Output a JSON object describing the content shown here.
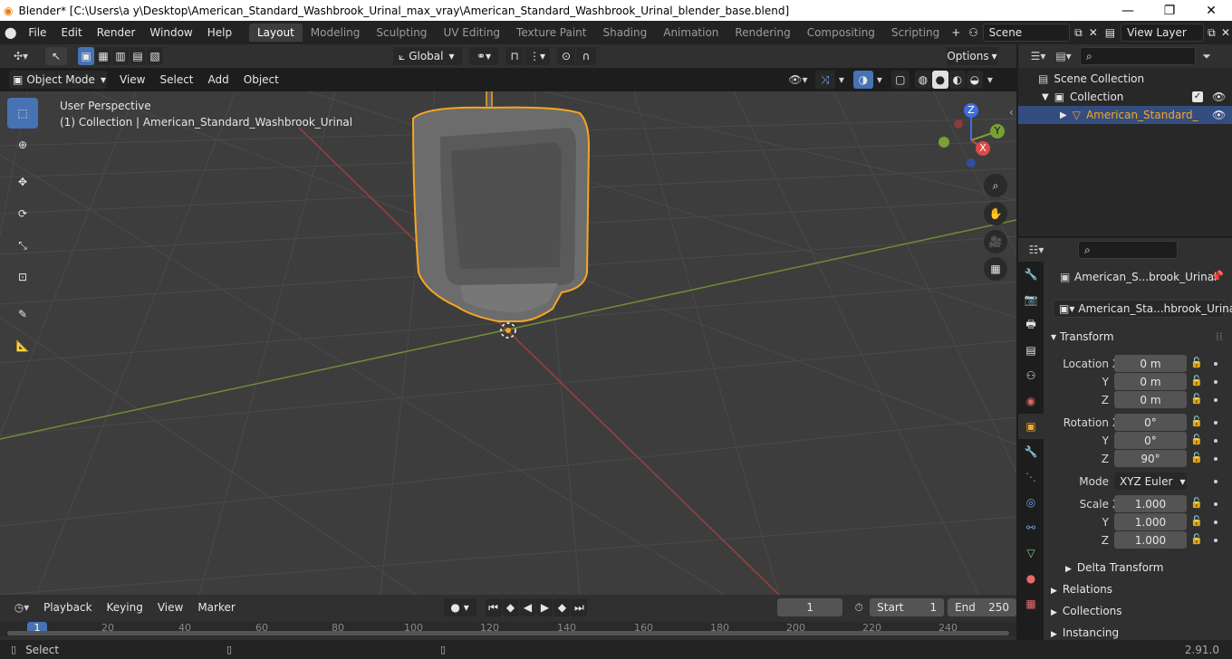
{
  "window": {
    "title": "Blender* [C:\\Users\\a y\\Desktop\\American_Standard_Washbrook_Urinal_max_vray\\American_Standard_Washbrook_Urinal_blender_base.blend]",
    "minimize": "—",
    "maximize": "❐",
    "close": "✕"
  },
  "menubar": [
    "File",
    "Edit",
    "Render",
    "Window",
    "Help"
  ],
  "workspaces": [
    "Layout",
    "Modeling",
    "Sculpting",
    "UV Editing",
    "Texture Paint",
    "Shading",
    "Animation",
    "Rendering",
    "Compositing",
    "Scripting"
  ],
  "active_workspace": "Layout",
  "add_workspace": "+",
  "scene": {
    "name": "Scene"
  },
  "view_layer": {
    "name": "View Layer"
  },
  "viewport_header": {
    "transform_orientation": "Global",
    "options_label": "Options"
  },
  "viewport_header2": {
    "mode": "Object Mode",
    "menus": [
      "View",
      "Select",
      "Add",
      "Object"
    ]
  },
  "viewport_info": {
    "line1": "User Perspective",
    "line2": "(1) Collection | American_Standard_Washbrook_Urinal"
  },
  "gizmo": {
    "x": "X",
    "y": "Y",
    "z": "Z"
  },
  "outliner": {
    "search_placeholder": "",
    "rows": [
      {
        "label": "Scene Collection"
      },
      {
        "label": "Collection"
      },
      {
        "label": "American_Standard_"
      }
    ]
  },
  "properties": {
    "object_name": "American_S...brook_Urinal",
    "data_name": "American_Sta...hbrook_Urinal",
    "transform_title": "Transform",
    "location_label": "Location X",
    "location": [
      "0 m",
      "0 m",
      "0 m"
    ],
    "rotation_label": "Rotation X",
    "rotation": [
      "0°",
      "0°",
      "90°"
    ],
    "mode_label": "Mode",
    "mode_value": "XYZ Euler",
    "scale_label": "Scale X",
    "scale": [
      "1.000",
      "1.000",
      "1.000"
    ],
    "axis_y": "Y",
    "axis_z": "Z",
    "delta_transform": "Delta Transform",
    "relations": "Relations",
    "collections": "Collections",
    "instancing": "Instancing"
  },
  "timeline": {
    "menus": [
      "Playback",
      "Keying",
      "View",
      "Marker"
    ],
    "current_frame": "1",
    "start_label": "Start",
    "start": "1",
    "end_label": "End",
    "end": "250",
    "ruler": [
      "1",
      "20",
      "40",
      "60",
      "80",
      "100",
      "120",
      "140",
      "160",
      "180",
      "200",
      "220",
      "240"
    ]
  },
  "statusbar": {
    "left": "Select",
    "version": "2.91.0"
  },
  "colors": {
    "accent": "#4772b3",
    "selection": "#f5a623",
    "x_axis": "#c84b4b",
    "y_axis": "#7aa035"
  }
}
